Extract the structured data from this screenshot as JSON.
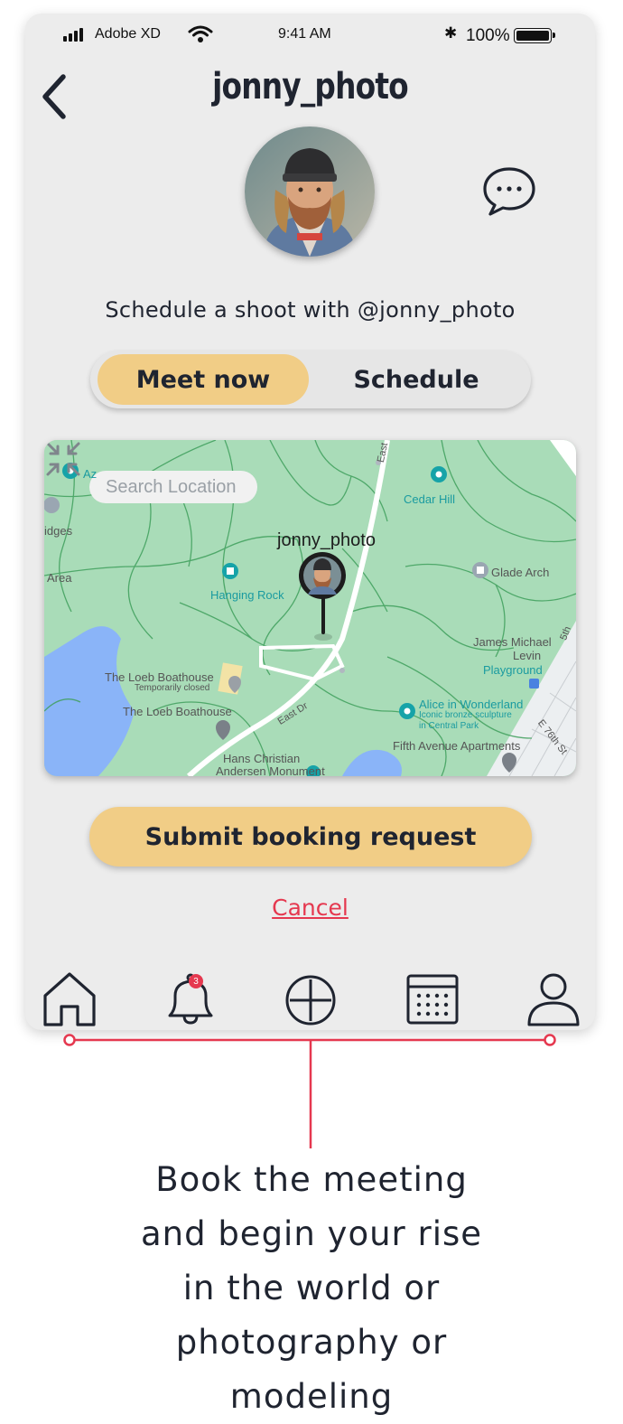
{
  "status_bar": {
    "carrier": "Adobe XD",
    "time": "9:41 AM",
    "battery": "100%"
  },
  "header": {
    "title": "jonny_photo"
  },
  "subtitle": "Schedule a shoot with @jonny_photo",
  "toggle": {
    "meet_now": "Meet now",
    "schedule": "Schedule",
    "selected": "Meet now"
  },
  "map": {
    "search_placeholder": "Search Location",
    "pin_label": "jonny_photo",
    "labels": {
      "cedar_hill": "Cedar Hill",
      "glade_arch": "Glade Arch",
      "hanging_rock": "Hanging Rock",
      "james_michael": "James Michael",
      "levin": "Levin",
      "playground": "Playground",
      "loeb_1": "The Loeb Boathouse",
      "loeb_closed": "Temporarily closed",
      "loeb_2": "The Loeb Boathouse",
      "alice": "Alice in Wonderland",
      "alice_sub1": "Iconic bronze sculpture",
      "alice_sub2": "in Central Park",
      "fifth_ave": "Fifth Avenue Apartments",
      "hans_1": "Hans Christian",
      "hans_2": "Andersen Monument",
      "east_dr": "East Dr",
      "east": "East",
      "area": "Area",
      "edges": "idges",
      "az": "Az",
      "e76": "E 76th St",
      "fifth": "5th"
    }
  },
  "submit_label": "Submit booking request",
  "cancel_label": "Cancel",
  "nav": {
    "notification_count": "3"
  },
  "caption": [
    "Book the meeting",
    "and begin your rise",
    "in the world or",
    "photography or",
    "modeling"
  ],
  "colors": {
    "accent": "#f1cd86",
    "danger": "#e5384f",
    "map_green": "#a8dab7",
    "water": "#8ab4f8"
  }
}
